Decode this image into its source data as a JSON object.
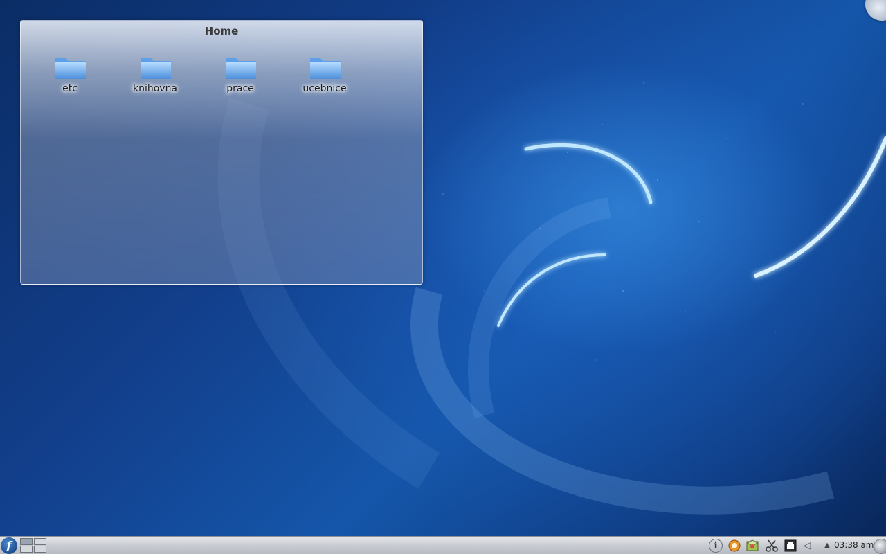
{
  "desktop": {
    "wallpaper": "fedora-blue-swirl",
    "colors": {
      "background_dark": "#0b2d66",
      "background_mid": "#1556aa",
      "swirl_glow": "#bfe8ff"
    }
  },
  "folder_view": {
    "title": "Home",
    "items": [
      {
        "label": "etc",
        "icon": "folder-icon"
      },
      {
        "label": "knihovna",
        "icon": "folder-icon"
      },
      {
        "label": "prace",
        "icon": "folder-icon"
      },
      {
        "label": "ucebnice",
        "icon": "folder-icon"
      }
    ]
  },
  "taskbar": {
    "launcher_icon": "fedora-logo-icon",
    "launcher_glyph": "f",
    "pager_desktops": 4,
    "tray": {
      "info_glyph": "i",
      "volume_glyph": "◁",
      "show_hidden_glyph": "▲",
      "icons": [
        "info-icon",
        "update-icon",
        "package-icon",
        "scissors-icon",
        "network-icon",
        "volume-icon",
        "show-hidden-icon"
      ]
    },
    "clock": "03:38 am"
  }
}
